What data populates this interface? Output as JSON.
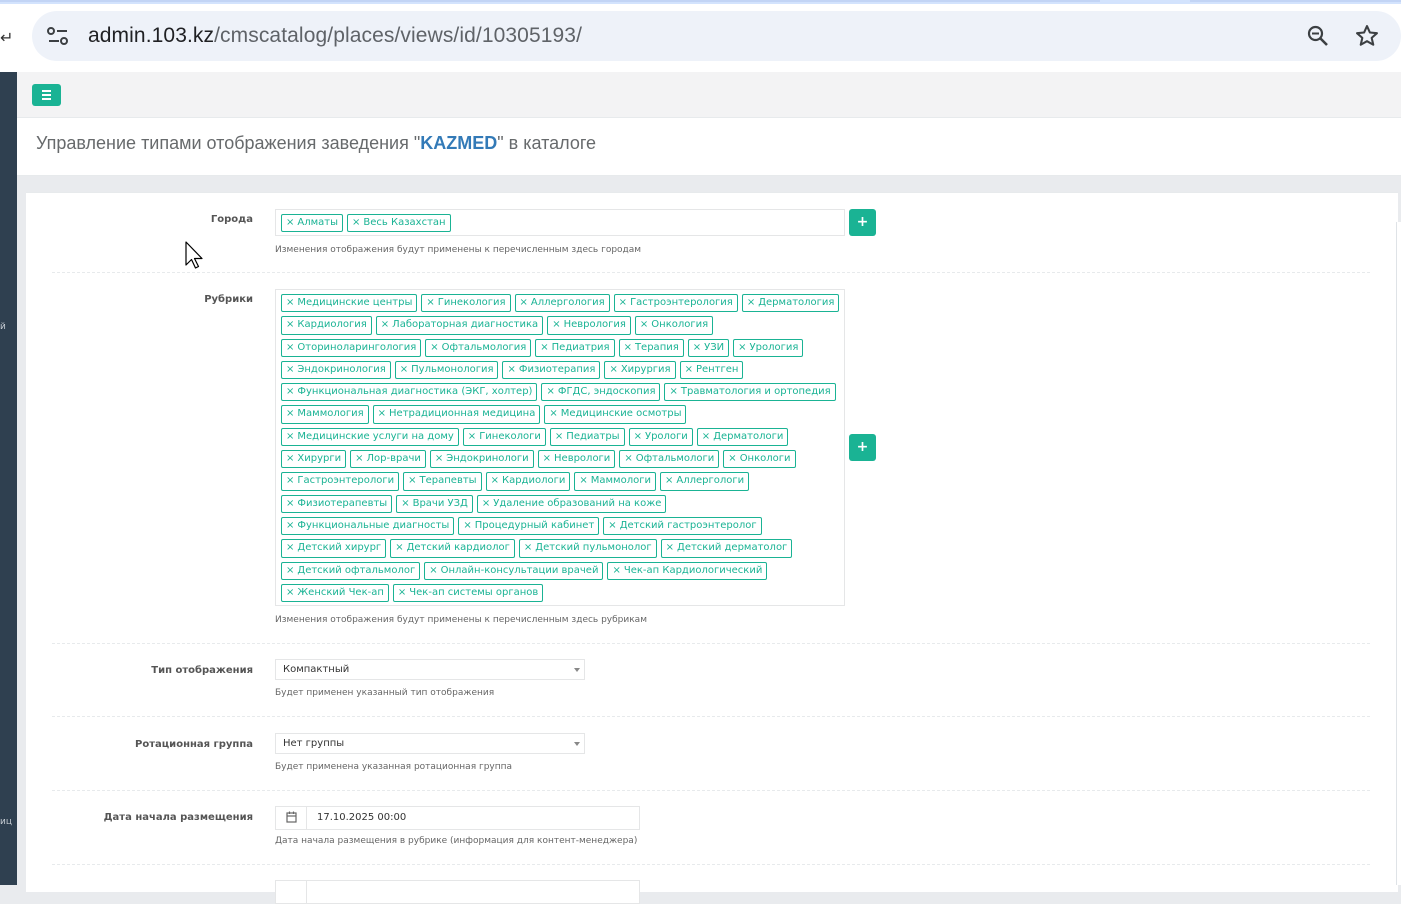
{
  "browser": {
    "url_host": "admin.103.kz",
    "url_path": "/cmscatalog/places/views/id/10305193/",
    "site_info_icon": "tune-icon",
    "zoom_icon": "zoom-out-icon",
    "bookmark_icon": "star-icon"
  },
  "sidebar": {
    "partial_texts": [
      "й",
      "иц"
    ]
  },
  "topbar": {
    "menu_icon": "hamburger-icon",
    "accent": "#1ab394"
  },
  "page": {
    "title_prefix": "Управление типами отображения заведения \"",
    "title_entity": "KAZMED",
    "title_suffix": "\" в каталоге"
  },
  "form": {
    "cities": {
      "label": "Города",
      "tags": [
        "Алматы",
        "Весь Казахстан"
      ],
      "help": "Изменения отображения будут применены к перечисленным здесь городам"
    },
    "rubrics": {
      "label": "Рубрики",
      "tags": [
        "Медицинские центры",
        "Гинекология",
        "Аллергология",
        "Гастроэнтерология",
        "Дерматология",
        "Кардиология",
        "Лабораторная диагностика",
        "Неврология",
        "Онкология",
        "Оториноларингология",
        "Офтальмология",
        "Педиатрия",
        "Терапия",
        "УЗИ",
        "Урология",
        "Эндокринология",
        "Пульмонология",
        "Физиотерапия",
        "Хирургия",
        "Рентген",
        "Функциональная диагностика (ЭКГ, холтер)",
        "ФГДС, эндоскопия",
        "Травматология и ортопедия",
        "Маммология",
        "Нетрадиционная медицина",
        "Медицинские осмотры",
        "Медицинские услуги на дому",
        "Гинекологи",
        "Педиатры",
        "Урологи",
        "Дерматологи",
        "Хирурги",
        "Лор-врачи",
        "Эндокринологи",
        "Неврологи",
        "Офтальмологи",
        "Онкологи",
        "Гастроэнтерологи",
        "Терапевты",
        "Кардиологи",
        "Маммологи",
        "Аллергологи",
        "Физиотерапевты",
        "Врачи УЗД",
        "Удаление образований на коже",
        "Функциональные диагносты",
        "Процедурный кабинет",
        "Детский гастроэнтеролог",
        "Детский хирург",
        "Детский кардиолог",
        "Детский пульмонолог",
        "Детский дерматолог",
        "Детский офтальмолог",
        "Онлайн-консультации врачей",
        "Чек-ап Кардиологический",
        "Женский Чек-ап",
        "Чек-ап системы органов"
      ],
      "help": "Изменения отображения будут применены к перечисленным здесь рубрикам"
    },
    "display_type": {
      "label": "Тип отображения",
      "value": "Компактный",
      "help": "Будет применен указанный тип отображения"
    },
    "rotation_group": {
      "label": "Ротационная группа",
      "value": "Нет группы",
      "help": "Будет применена указанная ротационная группа"
    },
    "start_date": {
      "label": "Дата начала размещения",
      "value": "17.10.2025 00:00",
      "help": "Дата начала размещения в рубрике (информация для контент-менеджера)",
      "icon": "calendar-icon"
    },
    "add_icon": "plus-icon",
    "tag_remove_glyph": "×"
  }
}
